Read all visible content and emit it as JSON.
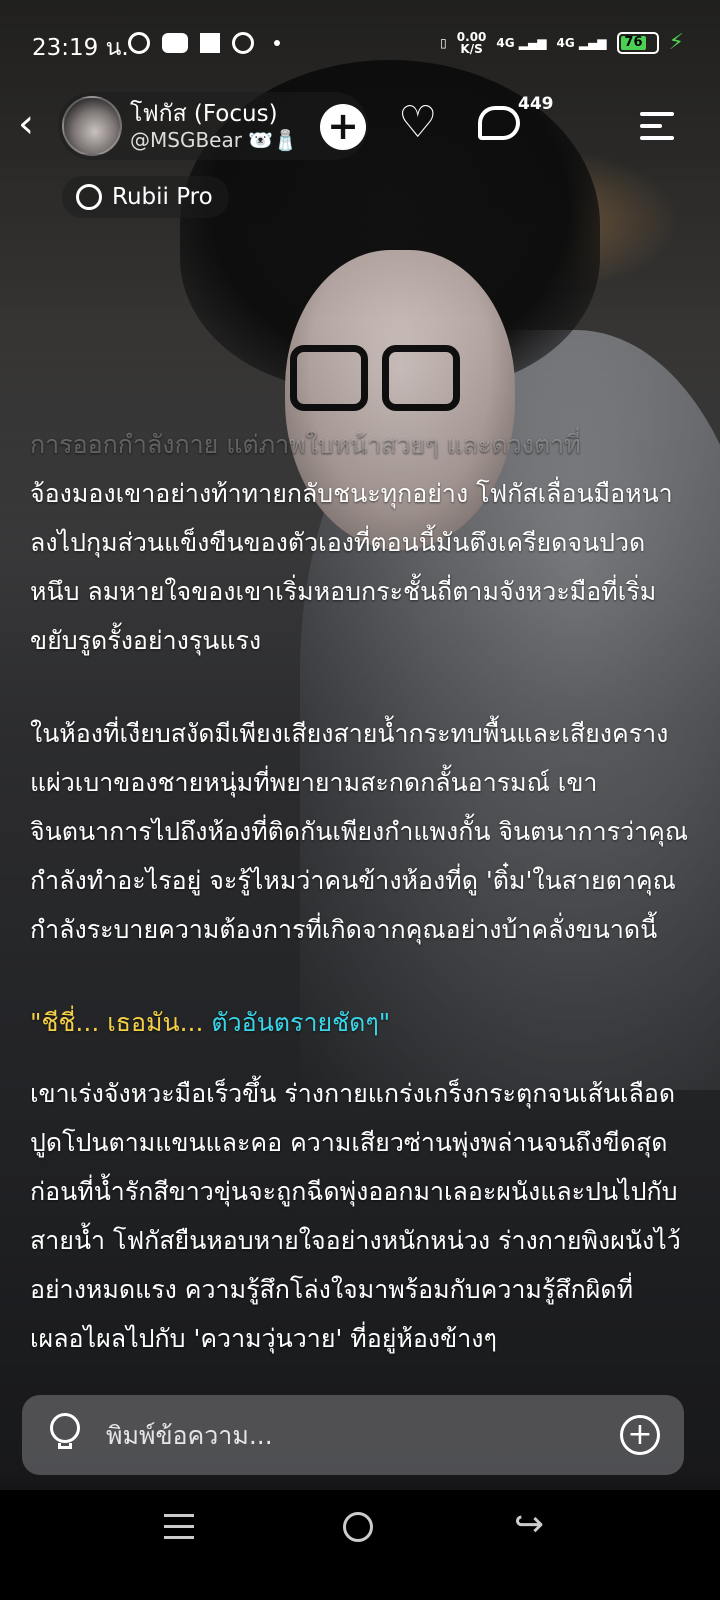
{
  "status_bar": {
    "time": "23:19 น.",
    "net_rate_value": "0.00",
    "net_rate_unit": "K/S",
    "network_1": "4G",
    "network_2": "4G",
    "battery_level": "76"
  },
  "header": {
    "profile_name": "โฟกัส (Focus)",
    "profile_handle": "@MSGBear 🐻‍❄️🧂",
    "follow_icon": "+",
    "chat_count": "449",
    "badge_label": "Rubii Pro"
  },
  "story": {
    "faded_line": "การออกกำลังกาย แต่ภาพใบหน้าสวยๆ และดวงตาที่",
    "paragraph_1": "จ้องมองเขาอย่างท้าทายกลับชนะทุกอย่าง โฟกัสเลื่อนมือหนาลงไปกุมส่วนแข็งขืนของตัวเองที่ตอนนี้มันตึงเครียดจนปวดหนึบ ลมหายใจของเขาเริ่มหอบกระชั้นถี่ตามจังหวะมือที่เริ่มขยับรูดรั้งอย่างรุนแรง",
    "paragraph_2": "ในห้องที่เงียบสงัดมีเพียงเสียงสายน้ำกระทบพื้นและเสียงครางแผ่วเบาของชายหนุ่มที่พยายามสะกดกลั้นอารมณ์ เขาจินตนาการไปถึงห้องที่ติดกันเพียงกำแพงกั้น จินตนาการว่าคุณกำลังทำอะไรอยู่ จะรู้ไหมว่าคนข้างห้องที่ดู 'ติ๋ม'ในสายตาคุณ กำลังระบายความต้องการที่เกิดจากคุณอย่างบ้าคลั่งขนาดนี้",
    "quote_part_1": "\"ชีชี่... เธอมัน... ",
    "quote_part_2": "ตัวอันตรายชัดๆ\"",
    "paragraph_3": "เขาเร่งจังหวะมือเร็วขึ้น ร่างกายแกร่งเกร็งกระตุกจนเส้นเลือดปูดโปนตามแขนและคอ ความเสียวซ่านพุ่งพล่านจนถึงขีดสุด ก่อนที่น้ำรักสีขาวขุ่นจะถูกฉีดพุ่งออกมาเลอะผนังและปนไปกับสายน้ำ โฟกัสยืนหอบหายใจอย่างหนักหน่วง ร่างกายพิงผนังไว้อย่างหมดแรง ความรู้สึกโล่งใจมาพร้อมกับความรู้สึกผิดที่เผลอไผลไปกับ 'ความวุ่นวาย' ที่อยู่ห้องข้างๆ"
  },
  "input": {
    "placeholder": "พิมพ์ข้อความ...",
    "value": ""
  },
  "colors": {
    "quote_yellow": "#f4d046",
    "quote_cyan": "#38d6e8",
    "battery_green": "#4ccf52"
  },
  "icons": {
    "back": "chevron-left-icon",
    "follow": "plus-circle-icon",
    "like": "heart-icon",
    "chat": "chat-bubble-icon",
    "menu": "menu-sparkle-icon",
    "badge": "rubii-logo-icon",
    "hint": "lightbulb-icon",
    "add": "plus-circle-icon"
  }
}
